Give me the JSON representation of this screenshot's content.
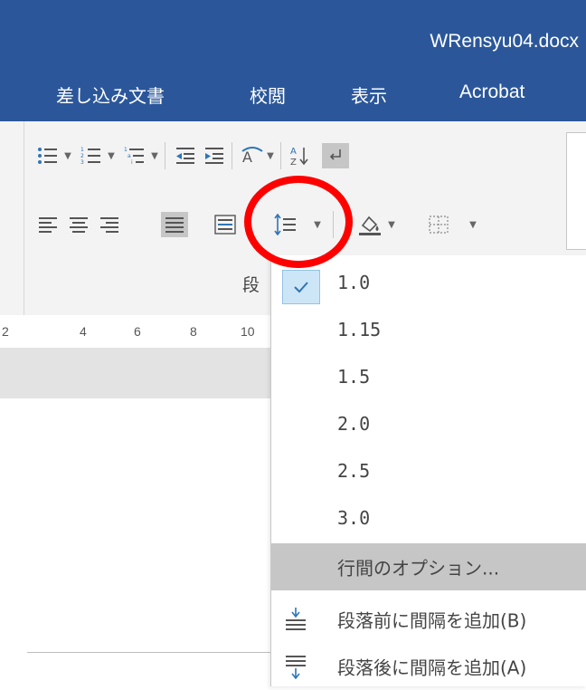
{
  "window": {
    "title": "WRensyu04.docx"
  },
  "tabs": [
    {
      "label": "差し込み文書"
    },
    {
      "label": "校閲"
    },
    {
      "label": "表示"
    },
    {
      "label": "Acrobat"
    }
  ],
  "ribbon": {
    "paragraph_group_label": "段",
    "tools": [
      "bullets-icon",
      "numbering-icon",
      "multilevel-list-icon",
      "decrease-indent-icon",
      "increase-indent-icon",
      "asian-layout-icon",
      "sort-icon",
      "show-marks-icon",
      "align-left-icon",
      "align-center-icon",
      "align-right-icon",
      "justify-icon",
      "distributed-icon",
      "line-spacing-icon",
      "shading-icon",
      "borders-icon"
    ]
  },
  "ruler": {
    "ticks": [
      "2",
      "4",
      "6",
      "8",
      "10"
    ]
  },
  "line_spacing_menu": {
    "selected": "1.0",
    "options": [
      "1.0",
      "1.15",
      "1.5",
      "2.0",
      "2.5",
      "3.0"
    ],
    "more_options": "行間のオプション...",
    "add_space_before": "段落前に間隔を追加(B)",
    "add_space_after": "段落後に間隔を追加(A)"
  },
  "colors": {
    "title_bar": "#2b579a",
    "highlight_circle": "#ff0000",
    "menu_hover": "#c6c6c6",
    "checked_background": "#cde6f7"
  }
}
